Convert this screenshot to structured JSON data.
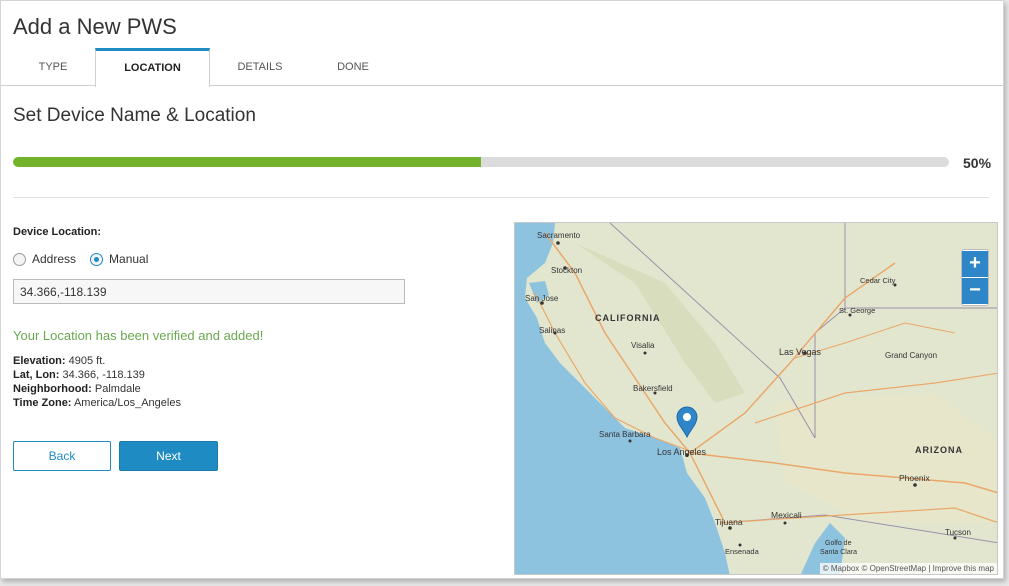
{
  "header": {
    "title": "Add a New PWS"
  },
  "tabs": [
    {
      "label": "TYPE"
    },
    {
      "label": "LOCATION"
    },
    {
      "label": "DETAILS"
    },
    {
      "label": "DONE"
    }
  ],
  "section": {
    "title": "Set Device Name & Location"
  },
  "progress": {
    "percent": 50,
    "label": "50%",
    "color": "#72b32b"
  },
  "form": {
    "location_label": "Device Location:",
    "radio_address": "Address",
    "radio_manual": "Manual",
    "selected": "Manual",
    "coordinates_value": "34.366,-118.139"
  },
  "verification": {
    "message": "Your Location has been verified and added!",
    "elevation_label": "Elevation:",
    "elevation_value": "4905 ft.",
    "latlon_label": "Lat, Lon:",
    "latlon_value": "34.366, -118.139",
    "neighborhood_label": "Neighborhood:",
    "neighborhood_value": "Palmdale",
    "timezone_label": "Time Zone:",
    "timezone_value": "America/Los_Angeles"
  },
  "buttons": {
    "back": "Back",
    "next": "Next"
  },
  "map": {
    "zoom_in": "+",
    "zoom_out": "−",
    "attribution_prefix": "© Mapbox © OpenStreetMap |",
    "attribution_link": "Improve this map",
    "labels": {
      "sacramento": "Sacramento",
      "stockton": "Stockton",
      "san_jose": "San Jose",
      "salinas": "Salinas",
      "california": "CALIFORNIA",
      "visalia": "Visalia",
      "bakersfield": "Bakersfield",
      "santa_barbara": "Santa Barbara",
      "los_angeles": "Los Angeles",
      "las_vegas": "Las Vegas",
      "cedar_city": "Cedar City",
      "st_george": "St. George",
      "grand_canyon": "Grand Canyon",
      "arizona": "ARIZONA",
      "phoenix": "Phoenix",
      "tucson": "Tucson",
      "mexicali": "Mexicali",
      "tijuana": "Tijuana",
      "ensenada": "Ensenada",
      "golfo": "Golfo de",
      "santa_clara": "Santa Clara"
    },
    "colors": {
      "land": "#e3e6cf",
      "water": "#8ec3e0",
      "roads": "#e9a86a",
      "marker": "#2e86c9"
    }
  }
}
